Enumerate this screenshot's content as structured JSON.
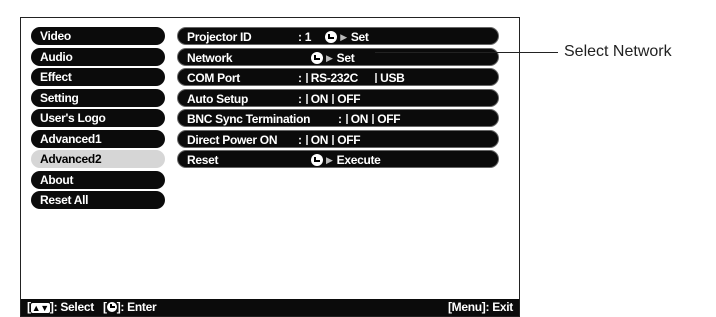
{
  "left_menu": [
    {
      "label": "Video"
    },
    {
      "label": "Audio"
    },
    {
      "label": "Effect"
    },
    {
      "label": "Setting"
    },
    {
      "label": "User's Logo"
    },
    {
      "label": "Advanced1"
    },
    {
      "label": "Advanced2",
      "selected": true
    },
    {
      "label": "About"
    },
    {
      "label": "Reset All"
    }
  ],
  "right_menu": {
    "projector_id": {
      "label": "Projector ID",
      "value": ": 1",
      "action": "Set"
    },
    "network": {
      "label": "Network",
      "action": "Set"
    },
    "com_port": {
      "label": "COM Port",
      "prefix": ":",
      "opt1": "RS-232C",
      "opt2": "USB"
    },
    "auto_setup": {
      "label": "Auto Setup",
      "prefix": ":",
      "opt1": "ON",
      "opt2": "OFF"
    },
    "bnc_sync": {
      "label": "BNC Sync Termination",
      "prefix": ":",
      "opt1": "ON",
      "opt2": "OFF"
    },
    "direct_power": {
      "label": "Direct Power ON",
      "prefix": ":",
      "opt1": "ON",
      "opt2": "OFF"
    },
    "reset": {
      "label": "Reset",
      "action": "Execute"
    }
  },
  "footer": {
    "select_label": "]: Select",
    "bracket_open": "[",
    "enter_label": "]: Enter",
    "exit_label": "[Menu]: Exit"
  },
  "callout": {
    "text": "Select Network"
  }
}
